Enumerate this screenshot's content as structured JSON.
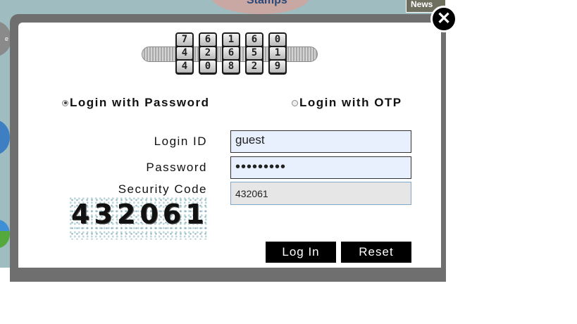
{
  "background": {
    "partial_title": "Stamps",
    "news_tab": "News"
  },
  "modal": {
    "close_glyph": "✕",
    "lock_digits": [
      [
        "7",
        "4",
        "4"
      ],
      [
        "6",
        "2",
        "0"
      ],
      [
        "1",
        "6",
        "8"
      ],
      [
        "6",
        "5",
        "2"
      ],
      [
        "0",
        "1",
        "9"
      ]
    ],
    "login_mode": {
      "password_label": "Login with Password",
      "otp_label": "Login with OTP",
      "selected": "password"
    },
    "login_id": {
      "label": "Login ID",
      "value": "guest"
    },
    "password": {
      "label": "Password",
      "masked_value": "•••••••••"
    },
    "security_code": {
      "label": "Security Code",
      "captcha_text": "432061",
      "entered_value": "432061"
    },
    "login_button": "Log In",
    "reset_button": "Reset"
  }
}
